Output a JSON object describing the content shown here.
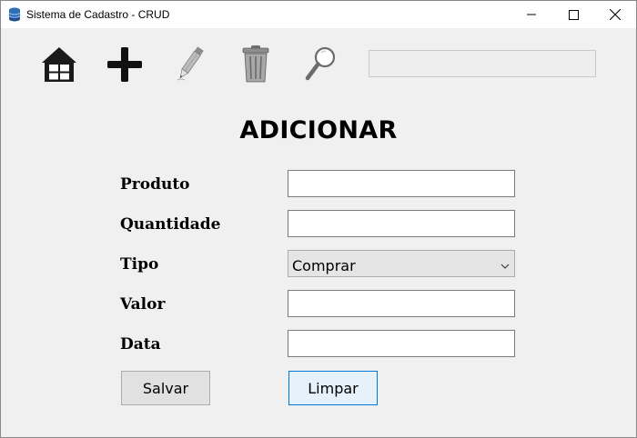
{
  "window": {
    "title": "Sistema de Cadastro - CRUD",
    "icon": "database-icon"
  },
  "toolbar": {
    "items": [
      {
        "name": "home",
        "icon": "home-icon"
      },
      {
        "name": "add",
        "icon": "plus-icon"
      },
      {
        "name": "edit",
        "icon": "pencil-icon"
      },
      {
        "name": "delete",
        "icon": "trash-icon"
      },
      {
        "name": "search",
        "icon": "magnifier-icon"
      }
    ],
    "search": {
      "value": "",
      "placeholder": ""
    }
  },
  "form": {
    "heading": "ADICIONAR",
    "fields": {
      "produto": {
        "label": "Produto",
        "value": ""
      },
      "quantidade": {
        "label": "Quantidade",
        "value": ""
      },
      "tipo": {
        "label": "Tipo",
        "value": "Comprar"
      },
      "valor": {
        "label": "Valor",
        "value": ""
      },
      "data": {
        "label": "Data",
        "value": ""
      }
    },
    "buttons": {
      "save": "Salvar",
      "clear": "Limpar"
    }
  }
}
